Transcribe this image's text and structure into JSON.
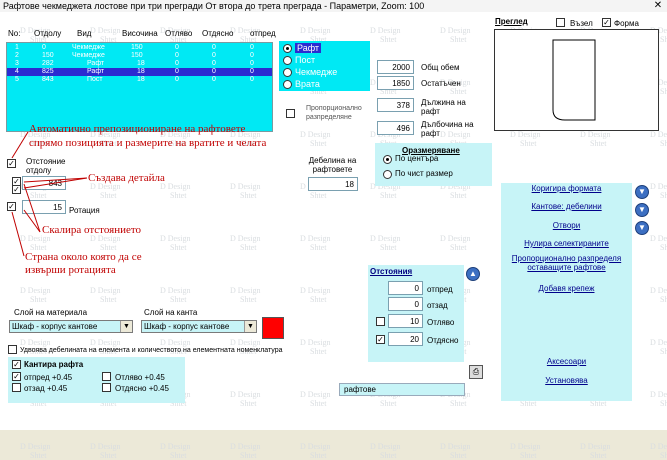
{
  "window": {
    "title": "Рафтове чекмеджета лостове при три прегради  От втора до трета преграда - Параметри,  Zoom:  100",
    "close": "✕"
  },
  "watermark": {
    "text1": "Design",
    "text2": "Shtet"
  },
  "list": {
    "headers": [
      "No:",
      "Отдолу",
      "Вид",
      "Височина",
      "Отляво",
      "Отдясно",
      "отпред"
    ],
    "rows": [
      {
        "no": "1",
        "otdolu": "0",
        "vid": "Чекмедже",
        "vis": "150",
        "otl": "0",
        "otd": "0",
        "otp": "0"
      },
      {
        "no": "2",
        "otdolu": "150",
        "vid": "Чекмедже",
        "vis": "150",
        "otl": "0",
        "otd": "0",
        "otp": "0"
      },
      {
        "no": "3",
        "otdolu": "282",
        "vid": "Рафт",
        "vis": "18",
        "otl": "0",
        "otd": "0",
        "otp": "0"
      },
      {
        "no": "4",
        "otdolu": "825",
        "vid": "Рафт",
        "vis": "18",
        "otl": "0",
        "otd": "0",
        "otp": "0"
      },
      {
        "no": "5",
        "otdolu": "843",
        "vid": "Пост",
        "vis": "18",
        "otl": "0",
        "otd": "0",
        "otp": "0"
      }
    ]
  },
  "types": {
    "options": [
      "Рафт",
      "Пост",
      "Чекмедже",
      "Врата"
    ],
    "selected": "Рафт"
  },
  "dims": {
    "obsht_label": "Общ обем",
    "obsht": "2000",
    "ostatak_label": "Остатъчен",
    "ostatak": "1850",
    "dalzhina_label": "Дължина на рафт",
    "dalzhina": "378",
    "dalbochina_label": "Дълбочина на рафт",
    "dalbochina": "496",
    "proporcionalno": "Пропорционално разпределяне"
  },
  "preview": {
    "label": "Преглед",
    "vazel": "Възел",
    "forma": "Форма"
  },
  "left": {
    "otstoyanie": "Отстояние отдолу",
    "otstoyanie_val": "843",
    "rotaciya_val": "15",
    "rotaciya": "Ротация",
    "debelina_label": "Дебелина на рафтовете",
    "debelina_val": "18"
  },
  "sizing": {
    "title": "Оразмеряване",
    "po_centara": "По центъра",
    "po_chist": "По чист размер"
  },
  "annotations": {
    "a1": "Автоматично препозициониране на рафтовете",
    "a2": "спрямо позицията и размерите на вратите и челата",
    "a3": "Създава детайла",
    "a4": "Скалира отстоянието",
    "a5": "Страна около която да се",
    "a6": "извърши ротацията"
  },
  "links": {
    "korigira": "Коригира формата",
    "kantove": "Кантове: дебелини",
    "otvori": "Отвори",
    "nulira": "Нулира селектираните",
    "proporc": "Пропорционално разпределя оставащите рафтове",
    "dobavya": "Добавя крепеж",
    "aksesoari": "Аксесоари",
    "ustanovyava": "Установява"
  },
  "otstoyaniya": {
    "title": "Отстояния",
    "otpred_label": "отпред",
    "otpred": "0",
    "otzad_label": "отзад",
    "otzad": "0",
    "otlyavo_label": "Отляво",
    "otlyavo": "10",
    "otdyasno_label": "Отдясно",
    "otdyasno": "20"
  },
  "layers": {
    "material_label": "Слой на материала",
    "material": "Шкаф - корпус кантове",
    "kant_label": "Слой на канта",
    "kant": "Шкаф - корпус кантове",
    "color": "#ff0000",
    "udvoyava": "Удвоява дебелината на елемента и количеството на елементната номенклатура"
  },
  "kantira": {
    "title": "Кантира рафта",
    "otpred": "отпред +0.45",
    "otzad": "отзад +0.45",
    "otlyavo": "Отляво +0.45",
    "otdyasno": "Отдясно +0.45"
  },
  "bottom_field": "рафтове"
}
